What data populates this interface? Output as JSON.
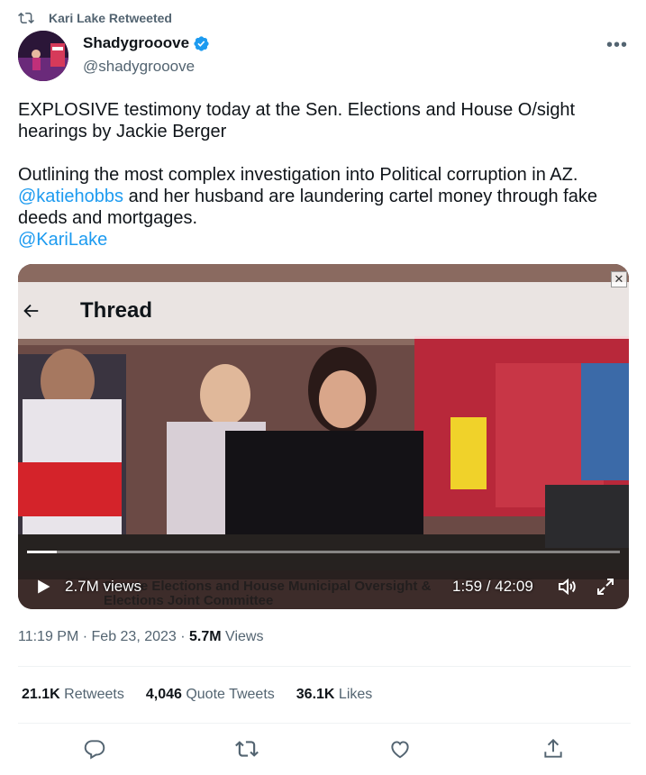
{
  "retweet": {
    "label": "Kari Lake Retweeted"
  },
  "author": {
    "name": "Shadygrooove",
    "handle": "@shadygrooove"
  },
  "tweet": {
    "line1": "EXPLOSIVE testimony today at the Sen. Elections and House O/sight hearings by Jackie Berger",
    "line2": "Outlining the most complex investigation into Political corruption in AZ.",
    "mention1": "@katiehobbs",
    "line3": " and her husband are laundering cartel money through fake deeds and mortgages.",
    "mention2": "@KariLake"
  },
  "media": {
    "thread_title": "Thread",
    "close_label": "✕",
    "views": "2.7M views",
    "time": "1:59 / 42:09",
    "caption": "Senate Elections and House Municipal Oversight &\nElections Joint Committee",
    "progress": 0.05
  },
  "meta": {
    "time": "11:19 PM",
    "sep1": " · ",
    "date": "Feb 23, 2023",
    "sep2": " · ",
    "views_count": "5.7M",
    "views_label": " Views"
  },
  "stats": {
    "retweets_count": "21.1K",
    "retweets_label": " Retweets",
    "quotes_count": "4,046",
    "quotes_label": " Quote Tweets",
    "likes_count": "36.1K",
    "likes_label": " Likes"
  },
  "colors": {
    "accent": "#1d9bf0",
    "muted": "#536471",
    "text": "#0f1419"
  },
  "icons": [
    "retweet-icon",
    "verified-icon",
    "more-icon",
    "back-arrow-icon",
    "play-icon",
    "volume-icon",
    "fullscreen-icon",
    "reply-icon",
    "like-icon",
    "share-icon"
  ]
}
